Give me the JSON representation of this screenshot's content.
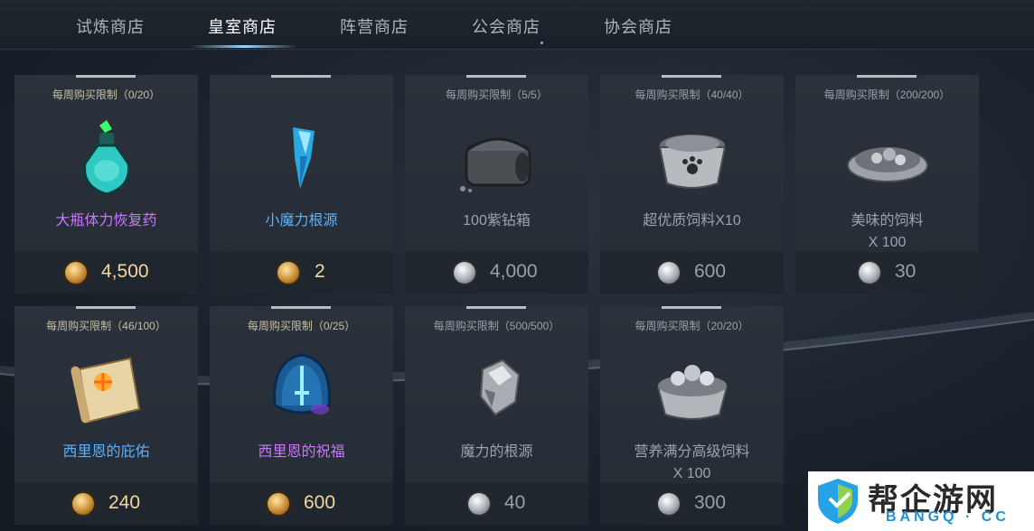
{
  "tabs": [
    {
      "label": "试炼商店",
      "active": false
    },
    {
      "label": "皇室商店",
      "active": true
    },
    {
      "label": "阵营商店",
      "active": false
    },
    {
      "label": "公会商店",
      "active": false
    },
    {
      "label": "协会商店",
      "active": false
    }
  ],
  "items": [
    {
      "limit": "每周购买限制（0/20）",
      "name": "大瓶体力恢复药",
      "name_color": "purple",
      "currency": "gold",
      "price": "4,500",
      "icon": "potion-icon"
    },
    {
      "limit": "",
      "name": "小魔力根源",
      "name_color": "blue",
      "currency": "gold",
      "price": "2",
      "icon": "crystal-icon"
    },
    {
      "limit": "每周购买限制（5/5）",
      "name": "100紫钻箱",
      "name_color": "gray",
      "currency": "silver",
      "price": "4,000",
      "icon": "chest-icon"
    },
    {
      "limit": "每周购买限制（40/40）",
      "name": "超优质饲料X10",
      "name_color": "gray",
      "currency": "silver",
      "price": "600",
      "icon": "pet-bowl-icon"
    },
    {
      "limit": "每周购买限制（200/200）",
      "name": "美味的饲料",
      "name2": "X 100",
      "name_color": "gray",
      "currency": "silver",
      "price": "30",
      "icon": "food-plate-icon"
    },
    {
      "limit": "每周购买限制（46/100）",
      "name": "西里恩的庇佑",
      "name_color": "blue",
      "currency": "gold",
      "price": "240",
      "icon": "scroll-icon"
    },
    {
      "limit": "每周购买限制（0/25）",
      "name": "西里恩的祝福",
      "name_color": "purple",
      "currency": "gold",
      "price": "600",
      "icon": "sword-orb-icon"
    },
    {
      "limit": "每周购买限制（500/500）",
      "name": "魔力的根源",
      "name_color": "gray",
      "currency": "silver",
      "price": "40",
      "icon": "ore-icon"
    },
    {
      "limit": "每周购买限制（20/20）",
      "name": "营养满分高级饲料",
      "name2": "X 100",
      "name_color": "gray",
      "currency": "silver",
      "price": "300",
      "icon": "food-bowl-icon"
    }
  ],
  "watermark": {
    "cn": "帮企游网",
    "en": "BANGQ · CC"
  }
}
